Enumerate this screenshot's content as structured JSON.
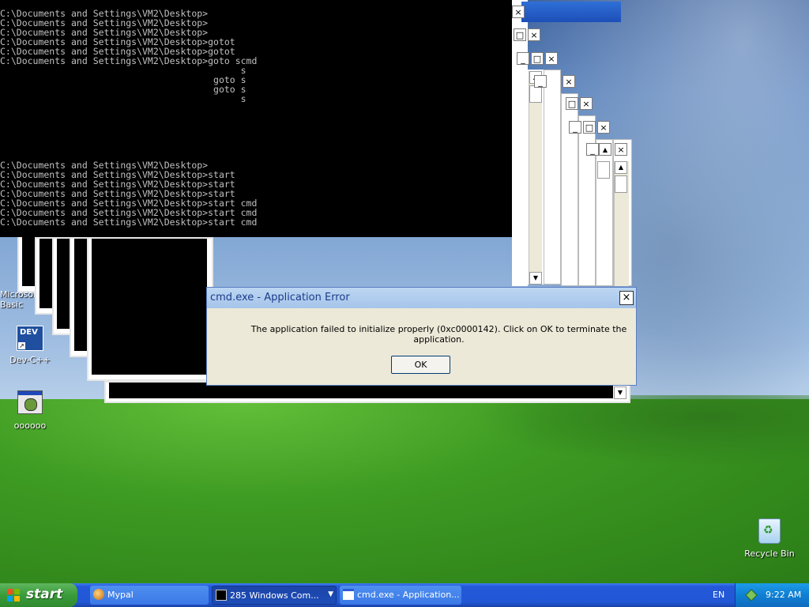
{
  "console": {
    "lines": [
      "C:\\Documents and Settings\\VM2\\Desktop>",
      "C:\\Documents and Settings\\VM2\\Desktop>",
      "C:\\Documents and Settings\\VM2\\Desktop>",
      "C:\\Documents and Settings\\VM2\\Desktop>gotot",
      "C:\\Documents and Settings\\VM2\\Desktop>gotot",
      "C:\\Documents and Settings\\VM2\\Desktop>goto scmd",
      "                                            s",
      "                                       goto s",
      "                                       goto s",
      "                                            s",
      "",
      "",
      "",
      "",
      "",
      "",
      "C:\\Documents and Settings\\VM2\\Desktop>",
      "C:\\Documents and Settings\\VM2\\Desktop>start",
      "C:\\Documents and Settings\\VM2\\Desktop>start",
      "C:\\Documents and Settings\\VM2\\Desktop>start",
      "C:\\Documents and Settings\\VM2\\Desktop>start cmd",
      "C:\\Documents and Settings\\VM2\\Desktop>start cmd",
      "C:\\Documents and Settings\\VM2\\Desktop>start cmd"
    ]
  },
  "window_buttons": {
    "minimize": "_",
    "maximize": "□",
    "close": "×",
    "scroll_up": "▲",
    "scroll_down": "▼"
  },
  "dialog": {
    "title": "cmd.exe - Application Error",
    "message": "The application failed to initialize properly (0xc0000142). Click on OK to terminate the application.",
    "ok_label": "OK",
    "close_glyph": "×"
  },
  "desktop_icons": [
    {
      "label": "Microsoft Basic",
      "icon": "visual-basic-icon"
    },
    {
      "label": "Dev-C++",
      "icon": "dev-cpp-icon"
    },
    {
      "label": "oooooo",
      "icon": "program-icon"
    },
    {
      "label": "Recycle Bin",
      "icon": "recycle-bin-icon"
    }
  ],
  "dev_icon_text": "DEV",
  "taskbar": {
    "start_label": "start",
    "tasks": [
      {
        "label": "Mypal",
        "icon": "mypal-icon"
      },
      {
        "label": "285 Windows Com...",
        "icon": "cmd-icon"
      },
      {
        "label": "cmd.exe - Application...",
        "icon": "window-icon"
      }
    ],
    "language": "EN",
    "clock": "9:22 AM"
  },
  "colors": {
    "taskbar": "#2458d8",
    "start": "#3a9b3a",
    "dialog_title": "#bcd6f2",
    "console_bg": "#000000",
    "console_text": "#c0c0c0"
  }
}
